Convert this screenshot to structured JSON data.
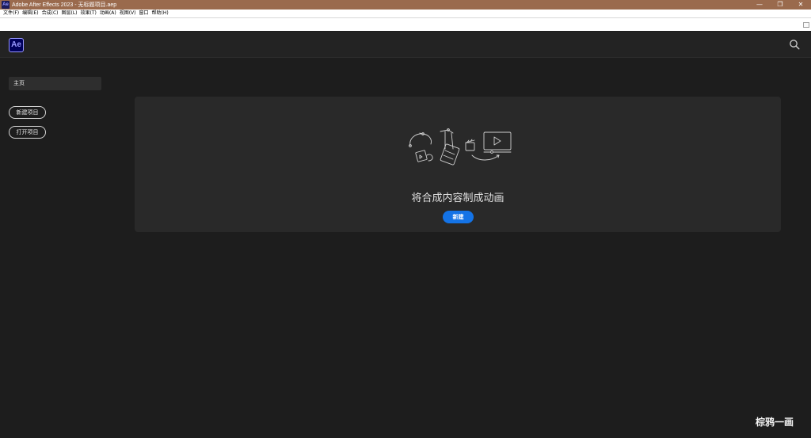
{
  "window": {
    "app_icon_text": "Ae",
    "title": "Adobe After Effects 2023 - 无标题项目.aep",
    "minimize": "—",
    "restore": "❐",
    "close": "✕"
  },
  "menu": {
    "items": [
      {
        "label": "文件(F)"
      },
      {
        "label": "编辑(E)"
      },
      {
        "label": "合成(C)"
      },
      {
        "label": "图层(L)"
      },
      {
        "label": "效果(T)"
      },
      {
        "label": "动画(A)"
      },
      {
        "label": "视图(V)"
      },
      {
        "label": "窗口"
      },
      {
        "label": "帮助(H)"
      }
    ]
  },
  "header": {
    "logo_text": "Ae",
    "search_icon": "search-icon"
  },
  "sidebar": {
    "home_label": "主页",
    "new_project_label": "新建项目",
    "open_project_label": "打开项目"
  },
  "main": {
    "heading": "将合成内容制成动画",
    "new_button_label": "新建"
  },
  "watermark": {
    "text": "棕鸦一画"
  },
  "colors": {
    "titlebar": "#9a6a4d",
    "background": "#1d1d1d",
    "card": "#292929",
    "accent": "#1473e6",
    "ae_logo_bg": "#00005b",
    "ae_logo_fg": "#9999ff"
  }
}
